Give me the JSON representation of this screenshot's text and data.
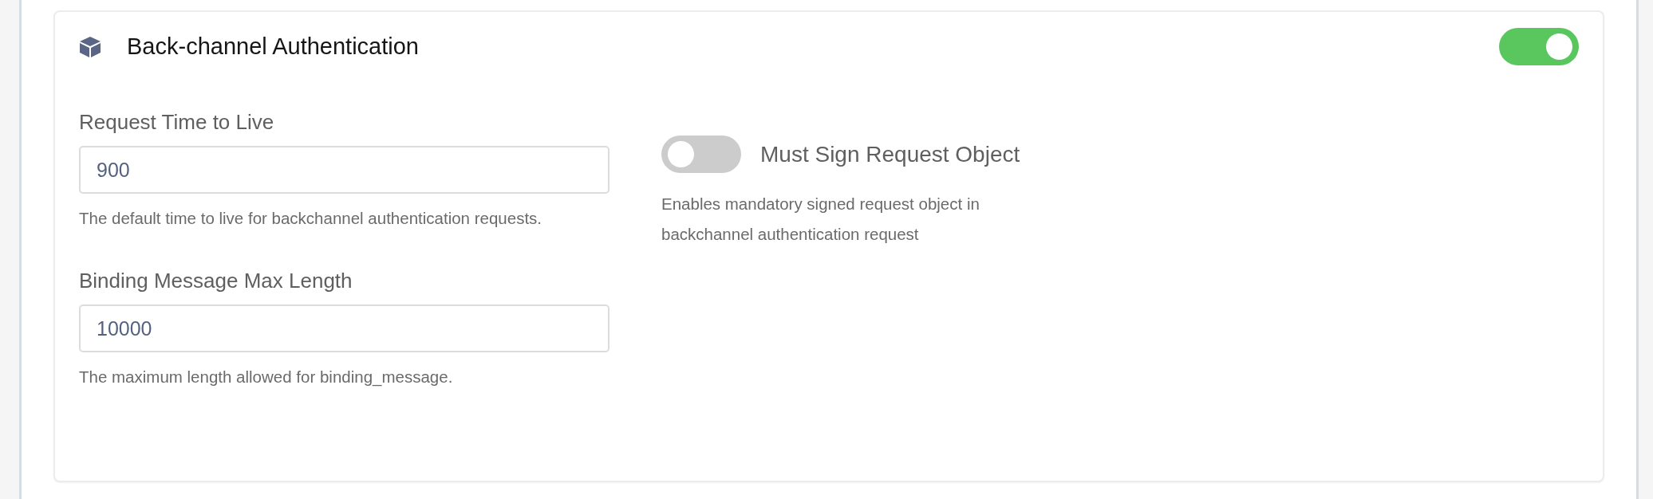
{
  "section": {
    "title": "Back-channel Authentication",
    "enabled": true
  },
  "fields": [
    {
      "label": "Request Time to Live",
      "value": "900",
      "help": "The default time to live for backchannel authentication requests."
    },
    {
      "label": "Binding Message Max Length",
      "value": "10000",
      "help": "The maximum length allowed for binding_message."
    }
  ],
  "switch": {
    "label": "Must Sign Request Object",
    "on": false,
    "help": "Enables mandatory signed request object in backchannel authentication request"
  }
}
